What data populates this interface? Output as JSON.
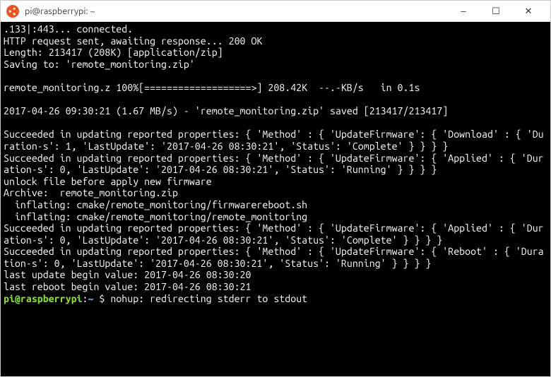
{
  "titlebar": {
    "title": "pi@raspberrypi: ~",
    "icon_name": "ubuntu-terminal-icon",
    "minimize_glyph": "–",
    "maximize_glyph": "☐",
    "close_glyph": "✕"
  },
  "prompt": {
    "user_host": "pi@raspberrypi",
    "colon": ":",
    "path": "~",
    "dollar": " $ "
  },
  "terminal_lines": [
    ".133|:443... connected.",
    "HTTP request sent, awaiting response... 200 OK",
    "Length: 213417 (208K) [application/zip]",
    "Saving to: 'remote_monitoring.zip'",
    "",
    "remote_monitoring.z 100%[===================>] 208.42K  --.-KB/s   in 0.1s",
    "",
    "2017-04-26 09:30:21 (1.67 MB/s) - 'remote_monitoring.zip' saved [213417/213417]",
    "",
    "Succeeded in updating reported properties: { 'Method' : { 'UpdateFirmware': { 'Download' : { 'Duration-s': 1, 'LastUpdate': '2017-04-26 08:30:21', 'Status': 'Complete' } } } }",
    "Succeeded in updating reported properties: { 'Method' : { 'UpdateFirmware': { 'Applied' : { 'Duration-s': 0, 'LastUpdate': '2017-04-26 08:30:21', 'Status': 'Running' } } } }",
    "unlock file before apply new firmware",
    "Archive:  remote_monitoring.zip",
    "  inflating: cmake/remote_monitoring/firmwarereboot.sh",
    "  inflating: cmake/remote_monitoring/remote_monitoring",
    "Succeeded in updating reported properties: { 'Method' : { 'UpdateFirmware': { 'Applied' : { 'Duration-s': 0, 'LastUpdate': '2017-04-26 08:30:21', 'Status': 'Complete' } } } }",
    "Succeeded in updating reported properties: { 'Method' : { 'UpdateFirmware': { 'Reboot' : { 'Duration-s': 0, 'LastUpdate': '2017-04-26 08:30:21', 'Status': 'Running' } } } }",
    "last update begin value: 2017-04-26 08:30:20",
    "last reboot begin value: 2017-04-26 08:30:21"
  ],
  "nohup_line": "nohup: redirecting stderr to stdout"
}
